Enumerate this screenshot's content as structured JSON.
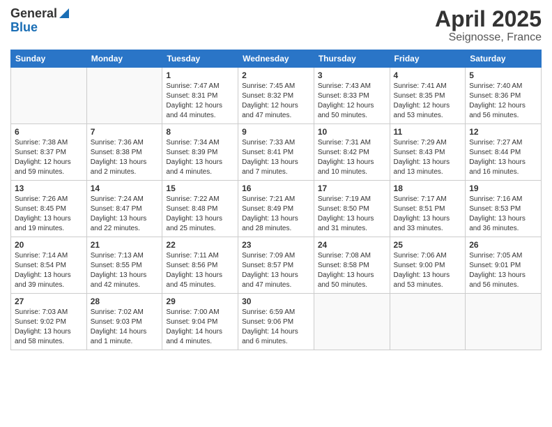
{
  "header": {
    "logo_general": "General",
    "logo_blue": "Blue",
    "title": "April 2025",
    "location": "Seignosse, France"
  },
  "weekdays": [
    "Sunday",
    "Monday",
    "Tuesday",
    "Wednesday",
    "Thursday",
    "Friday",
    "Saturday"
  ],
  "weeks": [
    [
      {
        "day": "",
        "detail": ""
      },
      {
        "day": "",
        "detail": ""
      },
      {
        "day": "1",
        "detail": "Sunrise: 7:47 AM\nSunset: 8:31 PM\nDaylight: 12 hours and 44 minutes."
      },
      {
        "day": "2",
        "detail": "Sunrise: 7:45 AM\nSunset: 8:32 PM\nDaylight: 12 hours and 47 minutes."
      },
      {
        "day": "3",
        "detail": "Sunrise: 7:43 AM\nSunset: 8:33 PM\nDaylight: 12 hours and 50 minutes."
      },
      {
        "day": "4",
        "detail": "Sunrise: 7:41 AM\nSunset: 8:35 PM\nDaylight: 12 hours and 53 minutes."
      },
      {
        "day": "5",
        "detail": "Sunrise: 7:40 AM\nSunset: 8:36 PM\nDaylight: 12 hours and 56 minutes."
      }
    ],
    [
      {
        "day": "6",
        "detail": "Sunrise: 7:38 AM\nSunset: 8:37 PM\nDaylight: 12 hours and 59 minutes."
      },
      {
        "day": "7",
        "detail": "Sunrise: 7:36 AM\nSunset: 8:38 PM\nDaylight: 13 hours and 2 minutes."
      },
      {
        "day": "8",
        "detail": "Sunrise: 7:34 AM\nSunset: 8:39 PM\nDaylight: 13 hours and 4 minutes."
      },
      {
        "day": "9",
        "detail": "Sunrise: 7:33 AM\nSunset: 8:41 PM\nDaylight: 13 hours and 7 minutes."
      },
      {
        "day": "10",
        "detail": "Sunrise: 7:31 AM\nSunset: 8:42 PM\nDaylight: 13 hours and 10 minutes."
      },
      {
        "day": "11",
        "detail": "Sunrise: 7:29 AM\nSunset: 8:43 PM\nDaylight: 13 hours and 13 minutes."
      },
      {
        "day": "12",
        "detail": "Sunrise: 7:27 AM\nSunset: 8:44 PM\nDaylight: 13 hours and 16 minutes."
      }
    ],
    [
      {
        "day": "13",
        "detail": "Sunrise: 7:26 AM\nSunset: 8:45 PM\nDaylight: 13 hours and 19 minutes."
      },
      {
        "day": "14",
        "detail": "Sunrise: 7:24 AM\nSunset: 8:47 PM\nDaylight: 13 hours and 22 minutes."
      },
      {
        "day": "15",
        "detail": "Sunrise: 7:22 AM\nSunset: 8:48 PM\nDaylight: 13 hours and 25 minutes."
      },
      {
        "day": "16",
        "detail": "Sunrise: 7:21 AM\nSunset: 8:49 PM\nDaylight: 13 hours and 28 minutes."
      },
      {
        "day": "17",
        "detail": "Sunrise: 7:19 AM\nSunset: 8:50 PM\nDaylight: 13 hours and 31 minutes."
      },
      {
        "day": "18",
        "detail": "Sunrise: 7:17 AM\nSunset: 8:51 PM\nDaylight: 13 hours and 33 minutes."
      },
      {
        "day": "19",
        "detail": "Sunrise: 7:16 AM\nSunset: 8:53 PM\nDaylight: 13 hours and 36 minutes."
      }
    ],
    [
      {
        "day": "20",
        "detail": "Sunrise: 7:14 AM\nSunset: 8:54 PM\nDaylight: 13 hours and 39 minutes."
      },
      {
        "day": "21",
        "detail": "Sunrise: 7:13 AM\nSunset: 8:55 PM\nDaylight: 13 hours and 42 minutes."
      },
      {
        "day": "22",
        "detail": "Sunrise: 7:11 AM\nSunset: 8:56 PM\nDaylight: 13 hours and 45 minutes."
      },
      {
        "day": "23",
        "detail": "Sunrise: 7:09 AM\nSunset: 8:57 PM\nDaylight: 13 hours and 47 minutes."
      },
      {
        "day": "24",
        "detail": "Sunrise: 7:08 AM\nSunset: 8:58 PM\nDaylight: 13 hours and 50 minutes."
      },
      {
        "day": "25",
        "detail": "Sunrise: 7:06 AM\nSunset: 9:00 PM\nDaylight: 13 hours and 53 minutes."
      },
      {
        "day": "26",
        "detail": "Sunrise: 7:05 AM\nSunset: 9:01 PM\nDaylight: 13 hours and 56 minutes."
      }
    ],
    [
      {
        "day": "27",
        "detail": "Sunrise: 7:03 AM\nSunset: 9:02 PM\nDaylight: 13 hours and 58 minutes."
      },
      {
        "day": "28",
        "detail": "Sunrise: 7:02 AM\nSunset: 9:03 PM\nDaylight: 14 hours and 1 minute."
      },
      {
        "day": "29",
        "detail": "Sunrise: 7:00 AM\nSunset: 9:04 PM\nDaylight: 14 hours and 4 minutes."
      },
      {
        "day": "30",
        "detail": "Sunrise: 6:59 AM\nSunset: 9:06 PM\nDaylight: 14 hours and 6 minutes."
      },
      {
        "day": "",
        "detail": ""
      },
      {
        "day": "",
        "detail": ""
      },
      {
        "day": "",
        "detail": ""
      }
    ]
  ]
}
